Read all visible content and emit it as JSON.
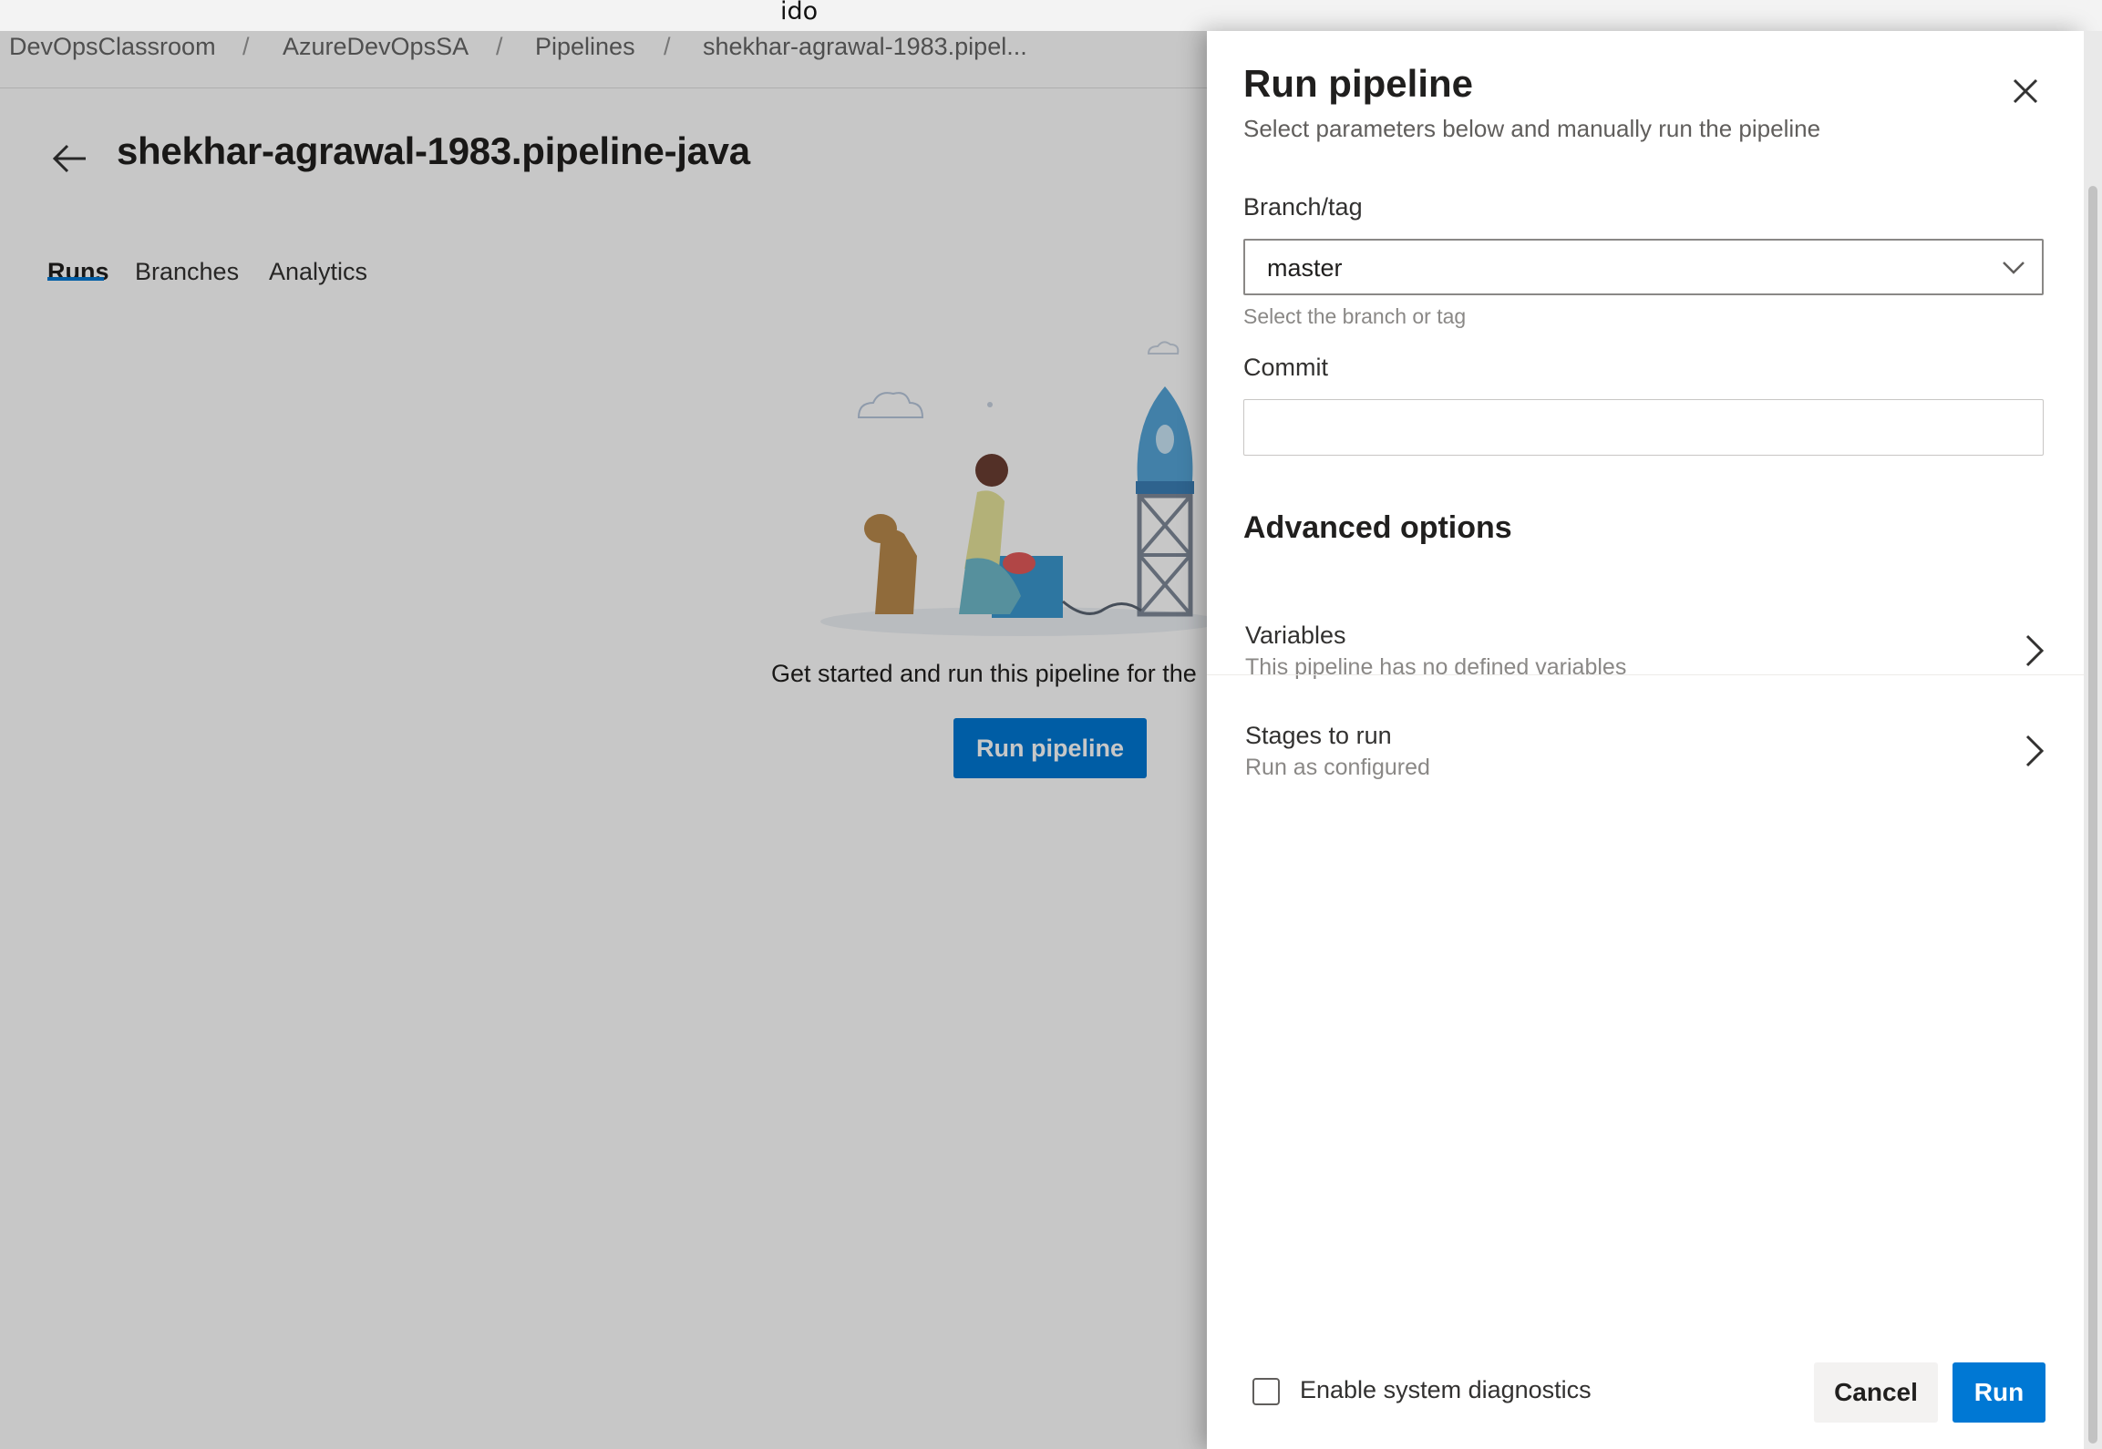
{
  "window": {
    "title": "ido"
  },
  "breadcrumb": {
    "items": [
      "DevOpsClassroom",
      "AzureDevOpsSA",
      "Pipelines",
      "shekhar-agrawal-1983.pipel..."
    ],
    "separator": "/"
  },
  "pipeline": {
    "title": "shekhar-agrawal-1983.pipeline-java",
    "tabs": [
      {
        "label": "Runs",
        "active": true
      },
      {
        "label": "Branches",
        "active": false
      },
      {
        "label": "Analytics",
        "active": false
      }
    ],
    "empty_state": {
      "message": "Get started and run this pipeline for the",
      "button_label": "Run pipeline"
    }
  },
  "panel": {
    "title": "Run pipeline",
    "subtitle": "Select parameters below and manually run the pipeline",
    "branch": {
      "label": "Branch/tag",
      "value": "master",
      "helper": "Select the branch or tag"
    },
    "commit": {
      "label": "Commit",
      "value": ""
    },
    "advanced": {
      "heading": "Advanced options",
      "options": [
        {
          "title": "Variables",
          "subtitle": "This pipeline has no defined variables"
        },
        {
          "title": "Stages to run",
          "subtitle": "Run as configured"
        }
      ]
    },
    "footer": {
      "diagnostics_label": "Enable system diagnostics",
      "diagnostics_checked": false,
      "cancel_label": "Cancel",
      "run_label": "Run"
    }
  },
  "colors": {
    "accent": "#0078d4",
    "overlay": "rgba(0,0,0,0.22)",
    "text": "#201f1e",
    "muted": "#8a8886"
  },
  "icons": {
    "back": "arrow-left-icon",
    "close": "close-icon",
    "dropdown": "chevron-down-icon",
    "row": "chevron-right-icon"
  }
}
